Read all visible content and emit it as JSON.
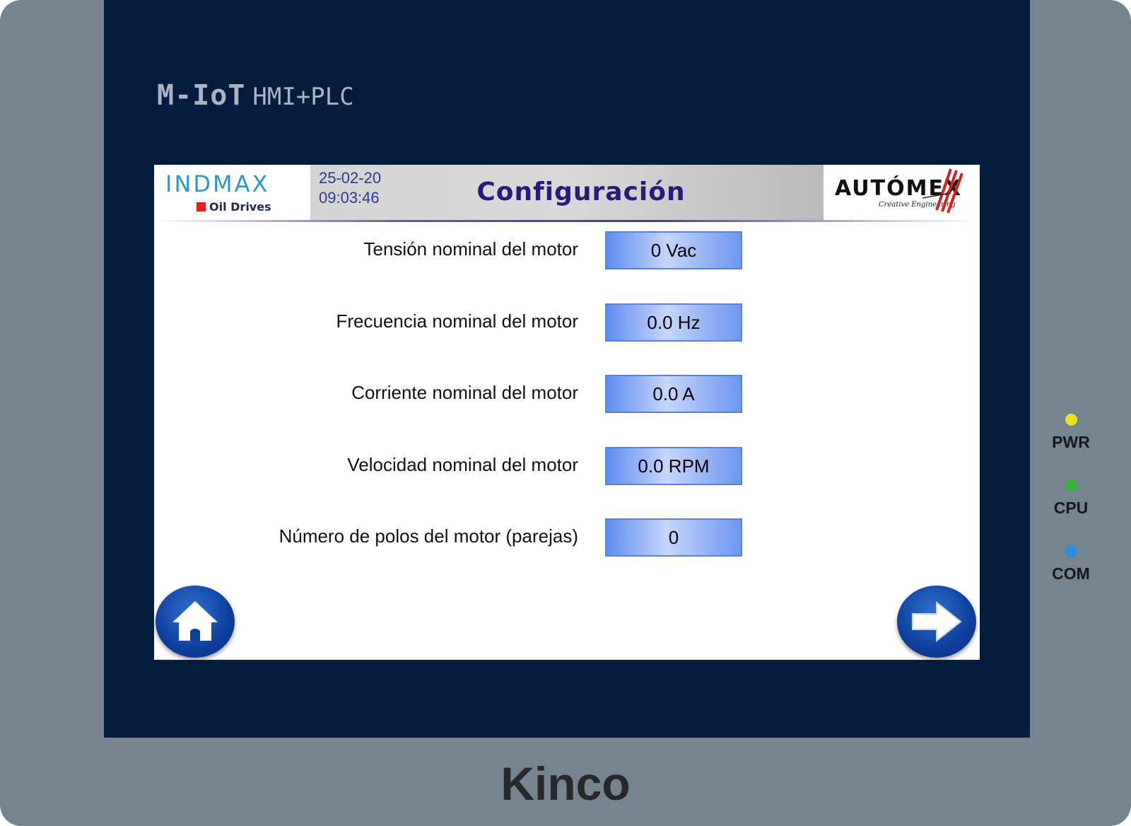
{
  "device": {
    "model_main": "M-IoT",
    "model_sub": "HMI+PLC",
    "brand": "Kinco",
    "leds": [
      {
        "label": "PWR",
        "color": "#e8e21c"
      },
      {
        "label": "CPU",
        "color": "#34b43c"
      },
      {
        "label": "COM",
        "color": "#2a8ee0"
      }
    ]
  },
  "header": {
    "left_logo": {
      "brand": "INDMAX",
      "sub": "Oil Drives",
      "color": "#2e95d3"
    },
    "date": "25-02-20",
    "time": "09:03:46",
    "title": "Configuración",
    "right_logo": {
      "brand": "AUTÓMEX",
      "tagline": "Creative Engineering"
    }
  },
  "fields": [
    {
      "label": "Tensión nominal del motor",
      "value": "0 Vac"
    },
    {
      "label": "Frecuencia nominal del motor",
      "value": "0.0 Hz"
    },
    {
      "label": "Corriente nominal del motor",
      "value": "0.0 A"
    },
    {
      "label": "Velocidad nominal del motor",
      "value": "0.0 RPM"
    },
    {
      "label": "Número de polos del motor (parejas)",
      "value": "0"
    }
  ],
  "navigation": {
    "home_icon": "home-icon",
    "next_icon": "arrow-right-icon"
  },
  "colors": {
    "bezel": "#041c3d",
    "device_body": "#76848f",
    "title": "#2b1a7a",
    "field_fill": "#6d96f1"
  }
}
